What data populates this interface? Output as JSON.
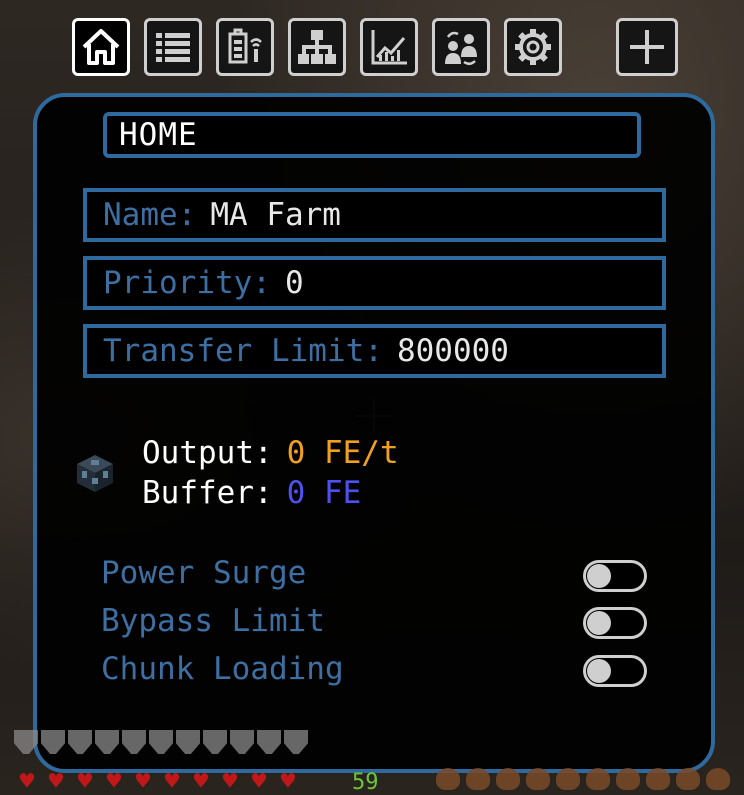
{
  "toolbar": {
    "tabs": [
      {
        "id": "home",
        "icon": "house-icon",
        "active": true
      },
      {
        "id": "list",
        "icon": "list-icon",
        "active": false
      },
      {
        "id": "battery",
        "icon": "wireless-battery-icon",
        "active": false
      },
      {
        "id": "network",
        "icon": "network-hierarchy-icon",
        "active": false
      },
      {
        "id": "stats",
        "icon": "line-chart-icon",
        "active": false
      },
      {
        "id": "users",
        "icon": "user-transfer-icon",
        "active": false
      },
      {
        "id": "settings",
        "icon": "gear-icon",
        "active": false
      }
    ],
    "add_icon": "plus-icon"
  },
  "page": {
    "title": "HOME"
  },
  "fields": {
    "name": {
      "label": "Name:",
      "value": "MA Farm"
    },
    "priority": {
      "label": "Priority:",
      "value": "0"
    },
    "transfer_limit": {
      "label": "Transfer Limit:",
      "value": "800000"
    }
  },
  "stats": {
    "output": {
      "label": "Output:",
      "value": "0 FE/t",
      "color": "#f0a020"
    },
    "buffer": {
      "label": "Buffer:",
      "value": "0 FE",
      "color": "#4f50f0"
    }
  },
  "options": [
    {
      "label": "Power Surge",
      "enabled": false
    },
    {
      "label": "Bypass Limit",
      "enabled": false
    },
    {
      "label": "Chunk Loading",
      "enabled": false
    }
  ],
  "hud": {
    "level": "59"
  },
  "colors": {
    "accent": "#2f6a9e",
    "label": "#3d6fa3",
    "tab_border": "#cfcfcf"
  }
}
